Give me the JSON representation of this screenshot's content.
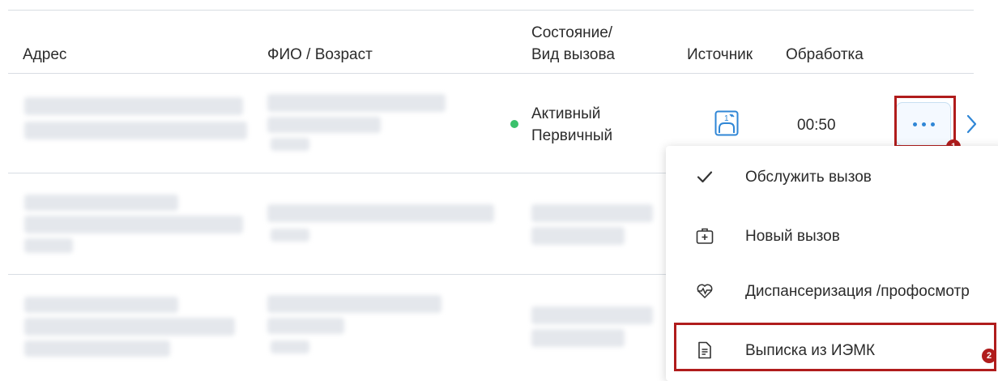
{
  "table": {
    "headers": {
      "address": "Адрес",
      "name_age": "ФИО / Возраст",
      "status_line1": "Состояние/",
      "status_line2": "Вид вызова",
      "source": "Источник",
      "processing": "Обработка"
    },
    "rows": [
      {
        "status": "Активный",
        "call_type": "Первичный",
        "processing_time": "00:50"
      }
    ]
  },
  "menu": {
    "items": [
      {
        "label": "Обслужить вызов",
        "icon": "check-icon"
      },
      {
        "label": "Новый вызов",
        "icon": "medical-bag-plus-icon"
      },
      {
        "label": "Диспансеризация /профосмотр",
        "icon": "heart-pulse-icon"
      },
      {
        "label": "Выписка из ИЭМК",
        "icon": "document-icon"
      }
    ]
  },
  "annotations": {
    "badge1": "1",
    "badge2": "2"
  },
  "colors": {
    "accent": "#2f86d6",
    "highlight": "#b01c1c",
    "active_dot": "#3ac16b"
  }
}
